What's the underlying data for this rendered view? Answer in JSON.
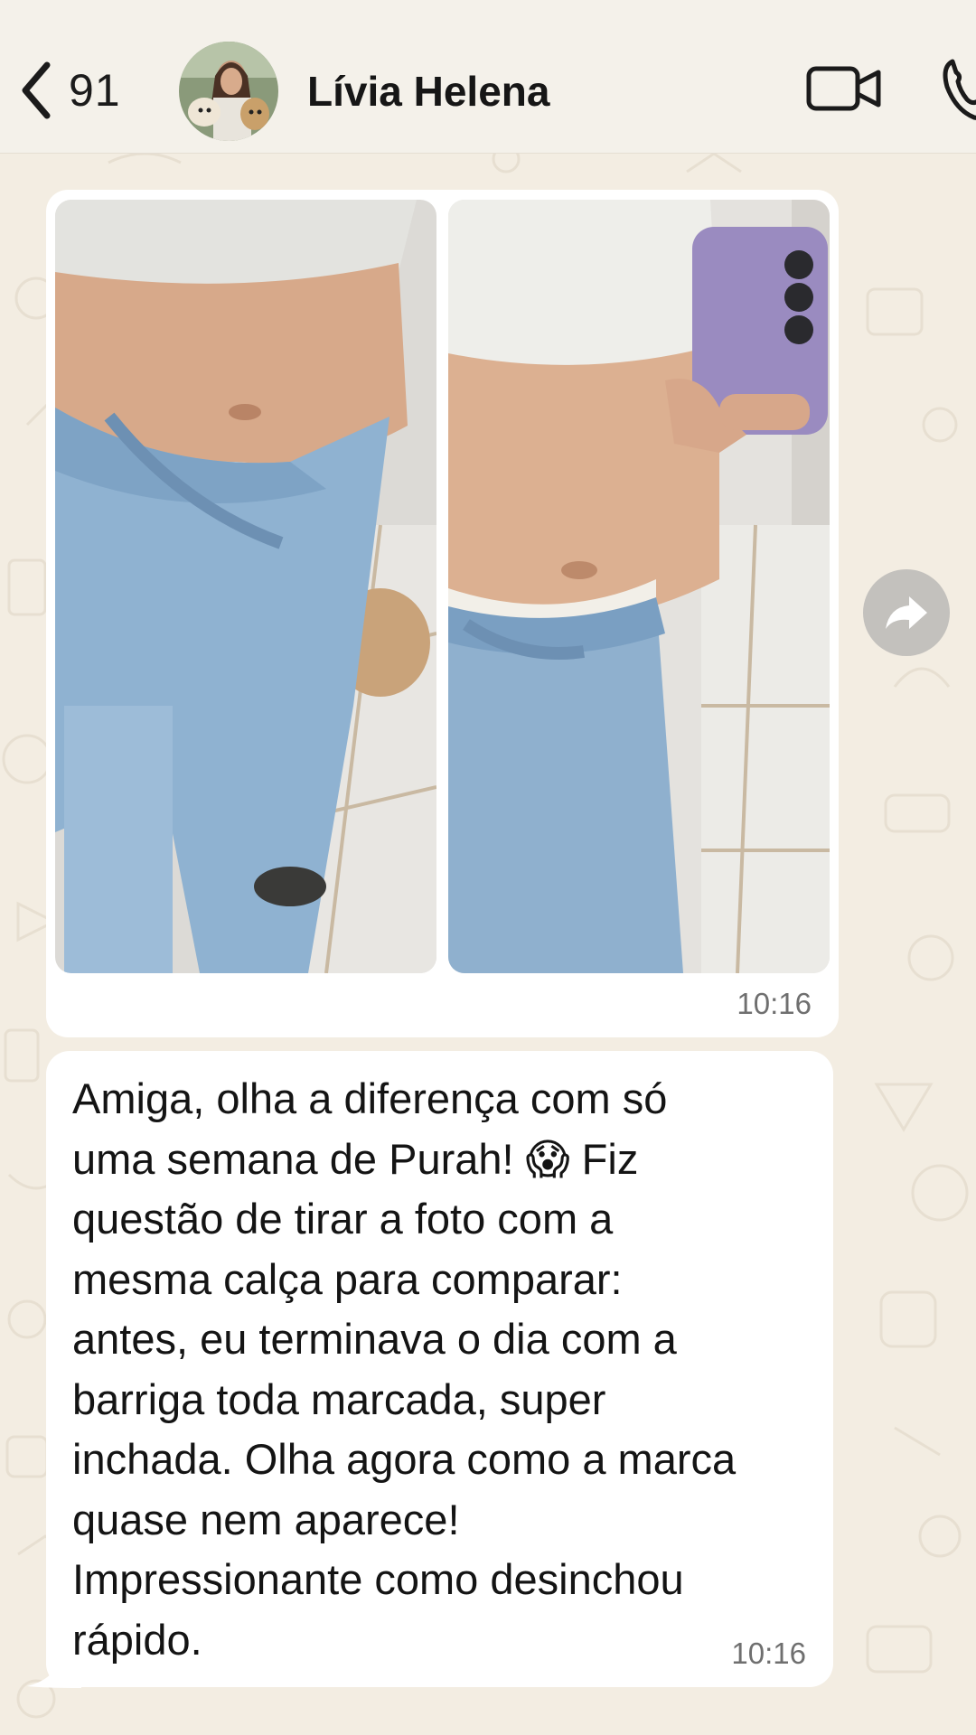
{
  "header": {
    "back_count": "91",
    "contact_name": "Lívia Helena",
    "back_icon": "chevron-left-icon",
    "video_icon": "video-camera-icon",
    "call_icon": "phone-icon"
  },
  "messages": [
    {
      "type": "image-pair",
      "time": "10:16"
    },
    {
      "type": "text",
      "text": "Amiga, olha a diferença com só\numa semana de Purah! 😱 Fiz\nquestão de tirar a foto com a\nmesma calça para comparar:\nantes, eu terminava o dia com a\nbarriga toda marcada, super\ninchada. Olha agora como a marca\nquase nem aparece!\nImpressionante como desinchou\nrápido.",
      "time": "10:16"
    }
  ],
  "colors": {
    "wallpaper": "#f3ede2",
    "bubble": "#ffffff",
    "header": "#f4f1ea",
    "forward_button": "#c3c1bd"
  }
}
